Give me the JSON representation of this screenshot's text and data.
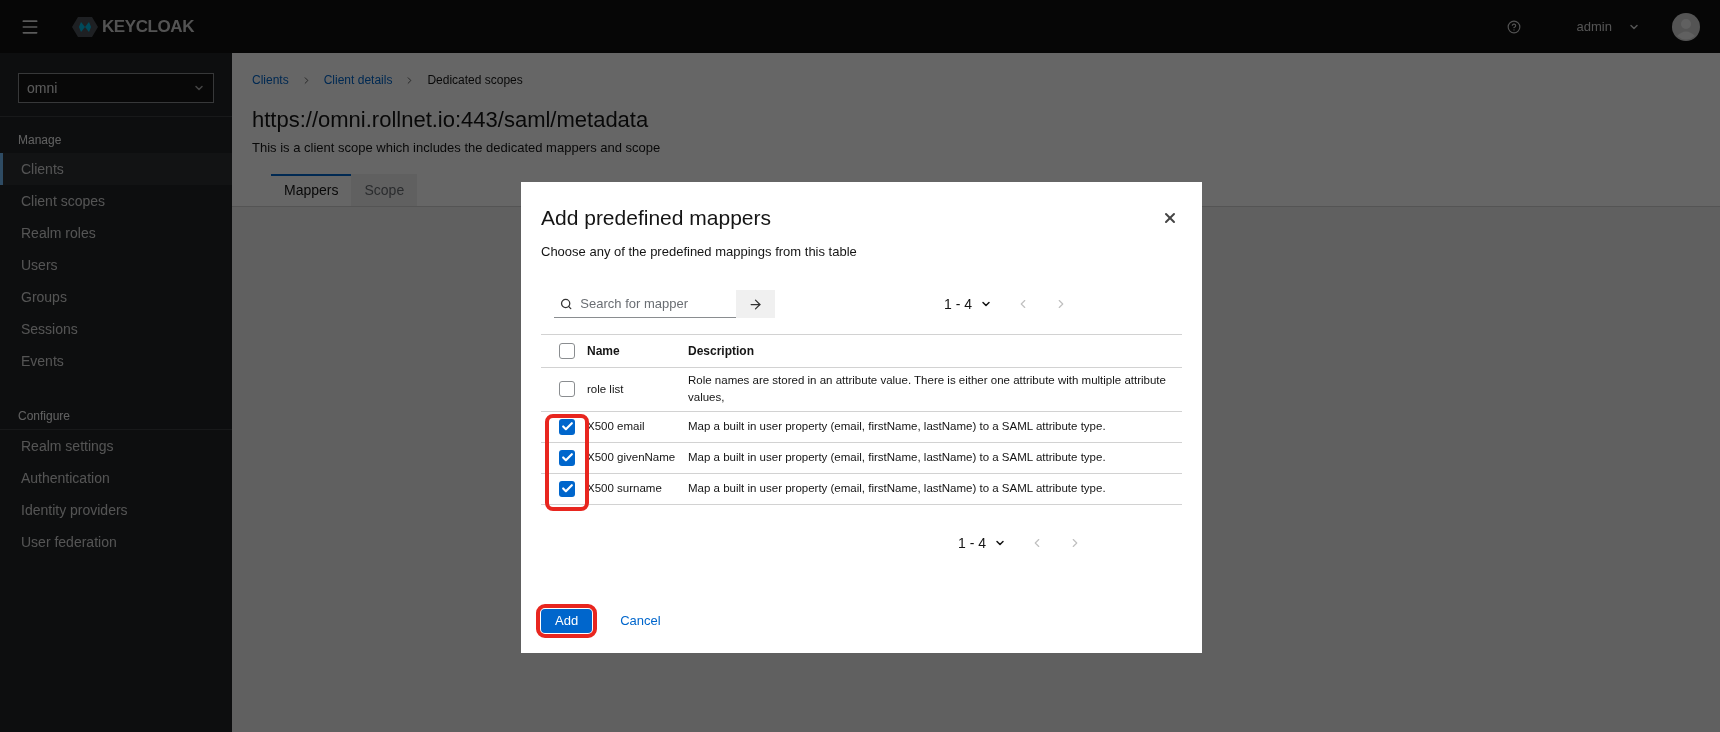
{
  "header": {
    "brand": "KEYCLOAK",
    "user": "admin"
  },
  "sidebar": {
    "realm": "omni",
    "sections": [
      {
        "label": "Manage",
        "items": [
          {
            "label": "Clients",
            "selected": true
          },
          {
            "label": "Client scopes",
            "selected": false
          },
          {
            "label": "Realm roles",
            "selected": false
          },
          {
            "label": "Users",
            "selected": false
          },
          {
            "label": "Groups",
            "selected": false
          },
          {
            "label": "Sessions",
            "selected": false
          },
          {
            "label": "Events",
            "selected": false
          }
        ]
      },
      {
        "label": "Configure",
        "items": [
          {
            "label": "Realm settings",
            "selected": false
          },
          {
            "label": "Authentication",
            "selected": false
          },
          {
            "label": "Identity providers",
            "selected": false
          },
          {
            "label": "User federation",
            "selected": false
          }
        ]
      }
    ]
  },
  "breadcrumb": [
    {
      "label": "Clients",
      "kind": "link"
    },
    {
      "label": "Client details",
      "kind": "link"
    },
    {
      "label": "Dedicated scopes",
      "kind": "current"
    }
  ],
  "page": {
    "title": "https://omni.rollnet.io:443/saml/metadata",
    "subtitle": "This is a client scope which includes the dedicated mappers and scope"
  },
  "tabs": [
    {
      "label": "Mappers",
      "selected": true
    },
    {
      "label": "Scope",
      "selected": false
    }
  ],
  "dialog": {
    "title": "Add predefined mappers",
    "subtitle": "Choose any of the predefined mappings from this table",
    "search": {
      "placeholder": "Search for mapper"
    },
    "pagination_top": "1 - 4",
    "table": {
      "select_all_checked": false,
      "columns": [
        "Name",
        "Description"
      ],
      "rows": [
        {
          "name": "role list",
          "description": "Role names are stored in an attribute value. There is either one attribute with multiple attribute values,",
          "checked": false,
          "highlighted": false
        },
        {
          "name": "X500 email",
          "description": "Map a built in user property (email, firstName, lastName) to a SAML attribute type.",
          "checked": true,
          "highlighted": true
        },
        {
          "name": "X500 givenName",
          "description": "Map a built in user property (email, firstName, lastName) to a SAML attribute type.",
          "checked": true,
          "highlighted": true
        },
        {
          "name": "X500 surname",
          "description": "Map a built in user property (email, firstName, lastName) to a SAML attribute type.",
          "checked": true,
          "highlighted": true
        }
      ]
    },
    "pagination_bottom": "1 - 4",
    "buttons": [
      {
        "label": "Add",
        "kind": "primary",
        "highlighted": true
      },
      {
        "label": "Cancel",
        "kind": "link",
        "highlighted": false
      }
    ]
  }
}
